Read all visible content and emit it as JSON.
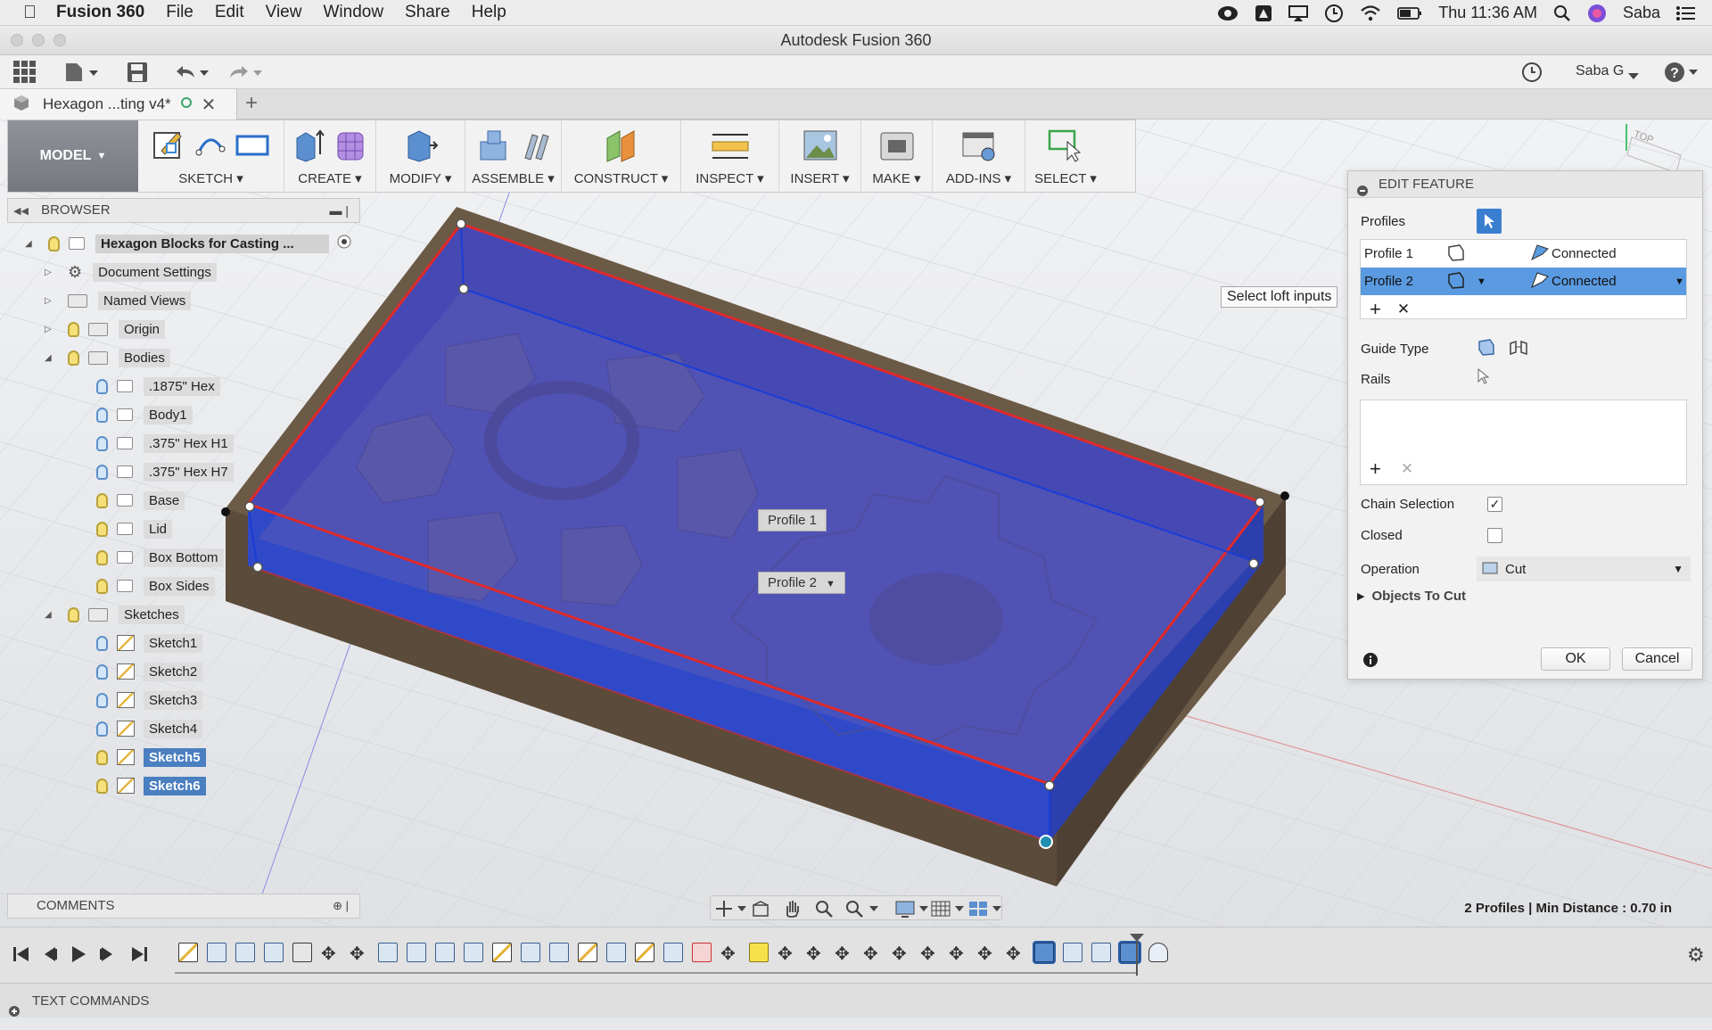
{
  "menubar": {
    "app_name": "Fusion 360",
    "menus": [
      "File",
      "Edit",
      "View",
      "Window",
      "Share",
      "Help"
    ],
    "clock": "Thu 11:36 AM",
    "user": "Saba"
  },
  "window": {
    "title": "Autodesk Fusion 360"
  },
  "qat": {
    "user_label": "Saba G"
  },
  "doc_tab": {
    "label": "Hexagon ...ting v4*"
  },
  "toolbar": {
    "workspace": "MODEL",
    "groups": [
      "SKETCH",
      "CREATE",
      "MODIFY",
      "ASSEMBLE",
      "CONSTRUCT",
      "INSPECT",
      "INSERT",
      "MAKE",
      "ADD-INS",
      "SELECT"
    ]
  },
  "browser": {
    "header": "BROWSER",
    "root": "Hexagon Blocks for Casting ...",
    "document_settings": "Document Settings",
    "named_views": "Named Views",
    "origin": "Origin",
    "bodies_folder": "Bodies",
    "bodies": [
      ".1875\" Hex",
      "Body1",
      ".375\" Hex H1",
      ".375\" Hex H7",
      "Base",
      "Lid",
      "Box Bottom",
      "Box Sides"
    ],
    "sketches_folder": "Sketches",
    "sketches": [
      "Sketch1",
      "Sketch2",
      "Sketch3",
      "Sketch4",
      "Sketch5",
      "Sketch6"
    ]
  },
  "edit_feature": {
    "title": "EDIT FEATURE",
    "profiles_label": "Profiles",
    "profile_rows": [
      {
        "name": "Profile 1",
        "status": "Connected"
      },
      {
        "name": "Profile 2",
        "status": "Connected"
      }
    ],
    "guide_type_label": "Guide Type",
    "rails_label": "Rails",
    "chain_selection_label": "Chain Selection",
    "chain_selection_checked": true,
    "closed_label": "Closed",
    "closed_checked": false,
    "operation_label": "Operation",
    "operation_value": "Cut",
    "objects_to_cut_label": "Objects To Cut",
    "ok_label": "OK",
    "cancel_label": "Cancel"
  },
  "tooltip": {
    "text": "Select loft inputs"
  },
  "canvas": {
    "profile1_label": "Profile 1",
    "profile2_label": "Profile 2",
    "view_cube_label": "TOP"
  },
  "comments": {
    "label": "COMMENTS"
  },
  "status": {
    "text": "2 Profiles | Min Distance : 0.70 in"
  },
  "text_commands": {
    "label": "TEXT COMMANDS"
  },
  "colors": {
    "accent": "#5a9ae0",
    "selection_blue": "#4a7fc0",
    "box_face": "#3f56c9",
    "profile_red": "#e0282c"
  }
}
